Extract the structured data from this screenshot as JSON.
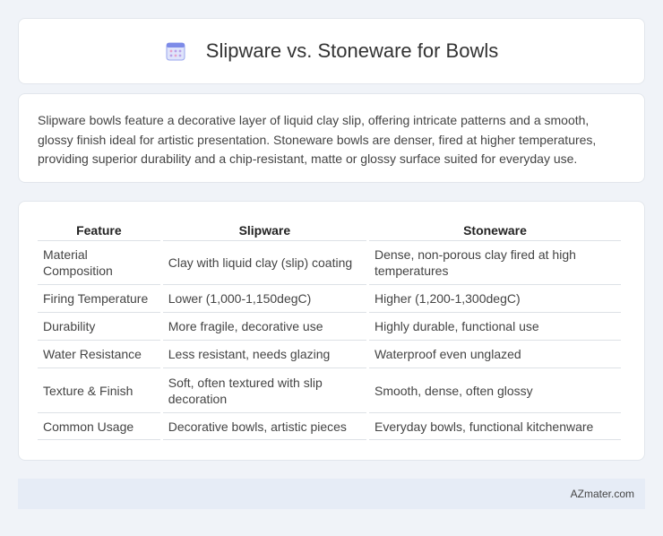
{
  "header": {
    "title": "Slipware vs. Stoneware for Bowls",
    "icon": "calendar-icon"
  },
  "summary": {
    "text": "Slipware bowls feature a decorative layer of liquid clay slip, offering intricate patterns and a smooth, glossy finish ideal for artistic presentation. Stoneware bowls are denser, fired at higher temperatures, providing superior durability and a chip-resistant, matte or glossy surface suited for everyday use."
  },
  "table": {
    "headers": [
      "Feature",
      "Slipware",
      "Stoneware"
    ],
    "rows": [
      [
        "Material Composition",
        "Clay with liquid clay (slip) coating",
        "Dense, non-porous clay fired at high temperatures"
      ],
      [
        "Firing Temperature",
        "Lower (1,000-1,150degC)",
        "Higher (1,200-1,300degC)"
      ],
      [
        "Durability",
        "More fragile, decorative use",
        "Highly durable, functional use"
      ],
      [
        "Water Resistance",
        "Less resistant, needs glazing",
        "Waterproof even unglazed"
      ],
      [
        "Texture & Finish",
        "Soft, often textured with slip decoration",
        "Smooth, dense, often glossy"
      ],
      [
        "Common Usage",
        "Decorative bowls, artistic pieces",
        "Everyday bowls, functional kitchenware"
      ]
    ]
  },
  "footer": {
    "brand": "AZmater.com"
  }
}
